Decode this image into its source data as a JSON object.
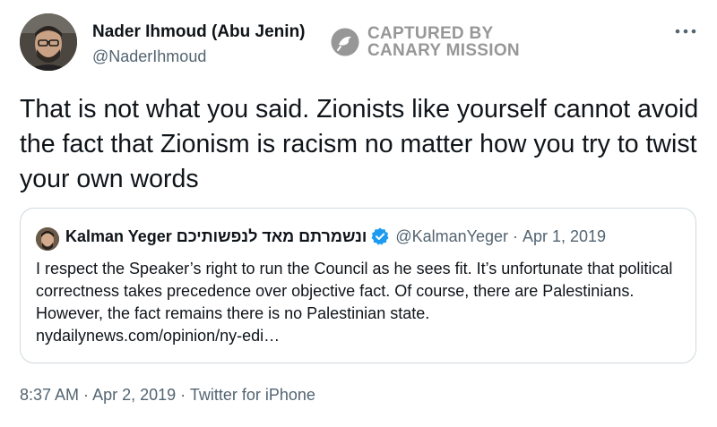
{
  "author": {
    "name": "Nader Ihmoud (Abu Jenin)",
    "handle": "@NaderIhmoud",
    "avatar_icon": "profile-photo"
  },
  "watermark": {
    "line1": "CAPTURED BY",
    "line2": "CANARY MISSION",
    "icon": "canary-mission-logo-icon"
  },
  "more_icon": "ellipsis-icon",
  "tweet": {
    "text": "That is not what you said. Zionists like yourself cannot avoid the fact that Zionism is racism no matter how you try to twist your own words"
  },
  "quoted_tweet": {
    "name": "Kalman Yeger ונשמרתם מאד לנפשותיכם",
    "verified": true,
    "handle": "@KalmanYeger",
    "separator": "·",
    "date": "Apr 1, 2019",
    "body": "I respect the Speaker’s right to run the Council as he sees fit.  It’s unfortunate that political correctness takes precedence over objective fact.  Of course, there are Palestinians.  However, the fact remains there is no Palestinian state.\nnydailynews.com/opinion/ny-edi…"
  },
  "meta": {
    "time": "8:37 AM",
    "sep1": " · ",
    "date": "Apr 2, 2019",
    "sep2": " · ",
    "source": "Twitter for iPhone"
  },
  "colors": {
    "text": "#0f1419",
    "secondary": "#536471",
    "border": "#cfd9de",
    "verified": "#1d9bf0"
  }
}
